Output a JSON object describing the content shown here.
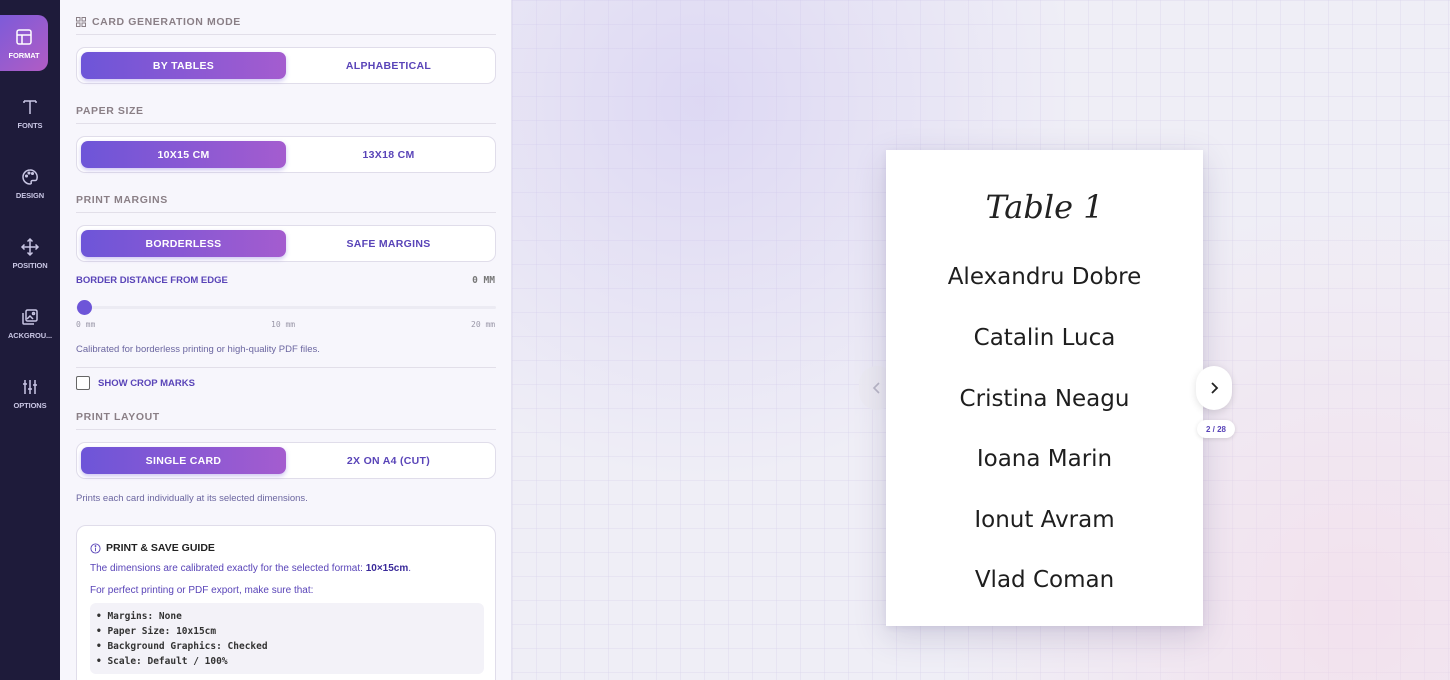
{
  "rail": {
    "items": [
      {
        "label": "FORMAT",
        "icon": "layout-icon",
        "active": true
      },
      {
        "label": "FONTS",
        "icon": "text-icon"
      },
      {
        "label": "DESIGN",
        "icon": "palette-icon"
      },
      {
        "label": "POSITION",
        "icon": "move-icon"
      },
      {
        "label": "ACKGROU...",
        "icon": "image-icon"
      },
      {
        "label": "OPTIONS",
        "icon": "sliders-icon"
      }
    ]
  },
  "panel": {
    "card_mode": {
      "title": "CARD GENERATION MODE",
      "options": [
        "BY TABLES",
        "ALPHABETICAL"
      ],
      "selected": "BY TABLES"
    },
    "paper_size": {
      "title": "PAPER SIZE",
      "options": [
        "10X15 CM",
        "13X18 CM"
      ],
      "selected": "10X15 CM"
    },
    "margins": {
      "title": "PRINT MARGINS",
      "options": [
        "BORDERLESS",
        "SAFE MARGINS"
      ],
      "selected": "BORDERLESS"
    },
    "border_distance": {
      "label": "BORDER DISTANCE FROM EDGE",
      "value": "0 MM",
      "slider_value_mm": 0,
      "slider_max_mm": 20,
      "ticks": [
        "0 mm",
        "10 mm",
        "20 mm"
      ],
      "help": "Calibrated for borderless printing or high-quality PDF files."
    },
    "crop_marks": {
      "label": "SHOW CROP MARKS",
      "checked": false
    },
    "layout": {
      "title": "PRINT LAYOUT",
      "options": [
        "SINGLE CARD",
        "2X ON A4 (CUT)"
      ],
      "selected": "SINGLE CARD",
      "help": "Prints each card individually at its selected dimensions."
    },
    "guide": {
      "title": "PRINT & SAVE GUIDE",
      "line1_prefix": "The dimensions are calibrated exactly for the selected format:",
      "line1_format": "10×15cm",
      "line1_suffix": ".",
      "line2": "For perfect printing or PDF export, make sure that:",
      "items": [
        "• Margins: None",
        "• Paper Size: 10x15cm",
        "• Background Graphics: Checked",
        "• Scale: Default / 100%"
      ]
    }
  },
  "preview": {
    "card_title": "Table 1",
    "guests": [
      "Alexandru Dobre",
      "Catalin Luca",
      "Cristina Neagu",
      "Ioana Marin",
      "Ionut Avram",
      "Vlad Coman"
    ],
    "pager": "2 / 28"
  },
  "colors": {
    "accent": "#6d55d8",
    "accent_end": "#a45ccf",
    "rail_bg": "#1e1b3a"
  }
}
